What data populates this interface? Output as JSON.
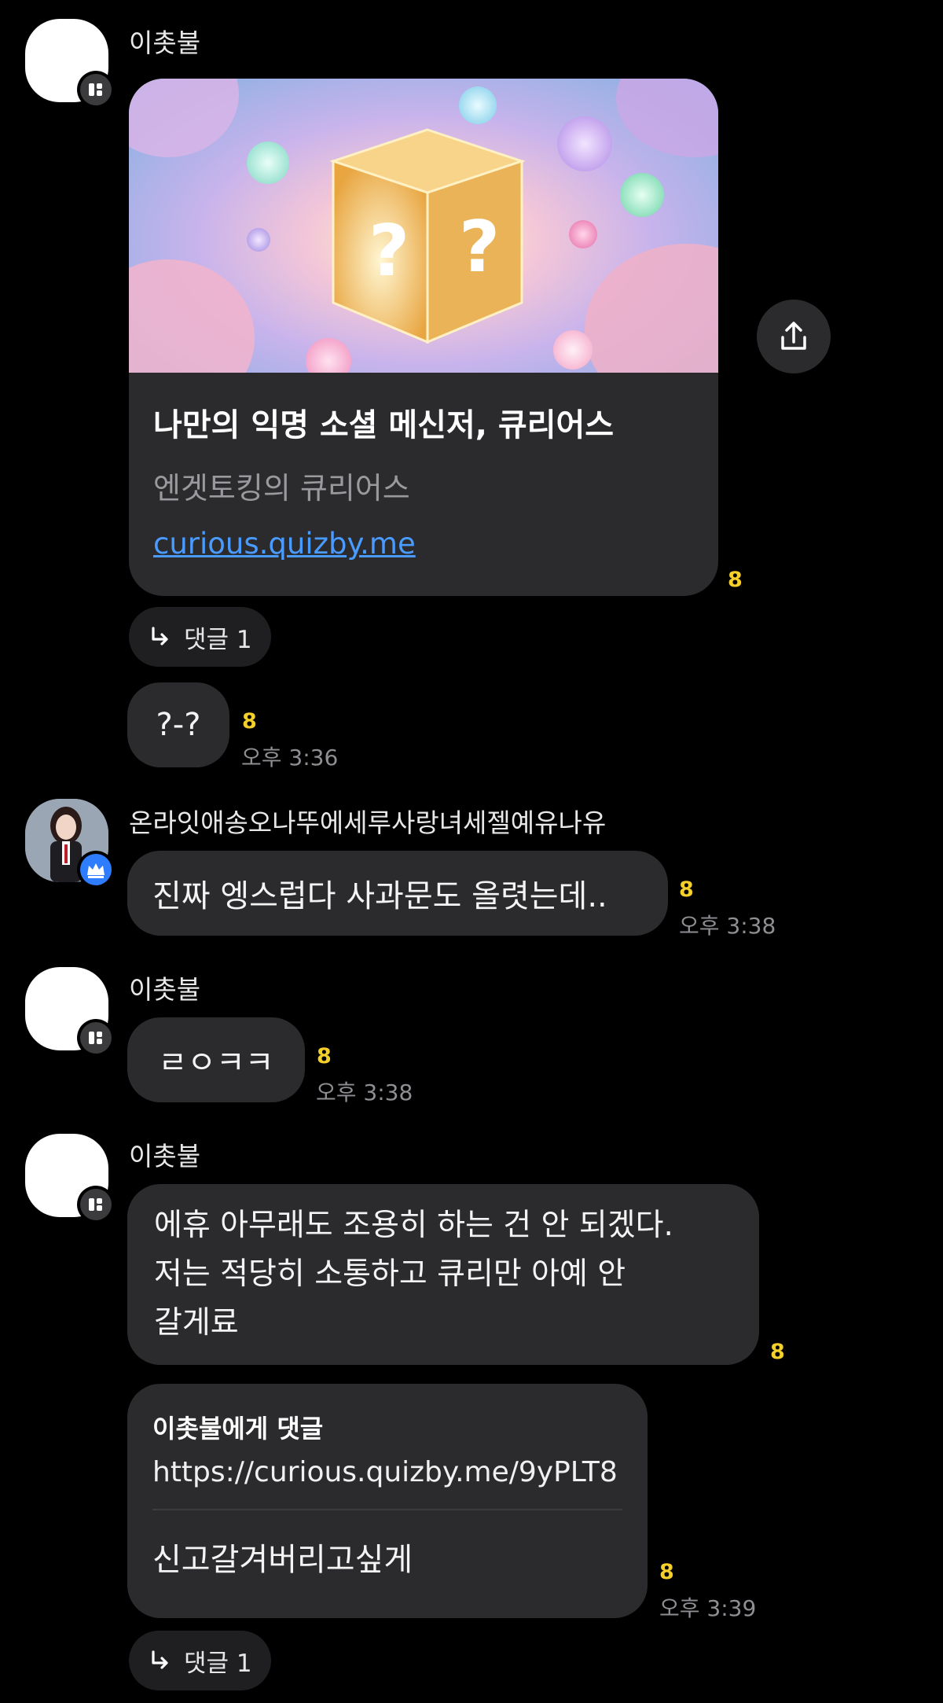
{
  "colors": {
    "background": "#000000",
    "bubble": "#2b2b2d",
    "read_count": "#f5d02a",
    "link": "#4a9bff",
    "badge_blue": "#2f7dff"
  },
  "messages": {
    "group1": {
      "sender": "이촛불",
      "card": {
        "title": "나만의 익명 소셜 메신저, 큐리어스",
        "subtitle": "엔겟토킹의 큐리어스",
        "link": "curious.quizby.me"
      },
      "card_read": "8",
      "reply_chip": "댓글 1",
      "short_msg": "?-?",
      "short_read": "8",
      "short_time": "오후 3:36"
    },
    "group2": {
      "sender": "온라잇애송오나뚜에세루사랑녀세젤예유나유",
      "text": "진짜 엥스럽다 사과문도 올렷는데..",
      "read": "8",
      "time": "오후 3:38"
    },
    "group3": {
      "sender": "이촛불",
      "text": "ㄹㅇㅋㅋ",
      "read": "8",
      "time": "오후 3:38"
    },
    "group4": {
      "sender": "이촛불",
      "text_lines": [
        "에휴 아무래도 조용히 하는 건 안 되겠다.",
        "저는 적당히 소통하고 큐리만 아예 안",
        "갈게료"
      ],
      "read": "8",
      "reply_box": {
        "header": "이촛불에게 댓글",
        "url": "https://curious.quizby.me/9yPLT8",
        "text": "신고갈겨버리고싶게"
      },
      "reply_read": "8",
      "reply_time": "오후 3:39",
      "reply_chip": "댓글 1"
    }
  }
}
